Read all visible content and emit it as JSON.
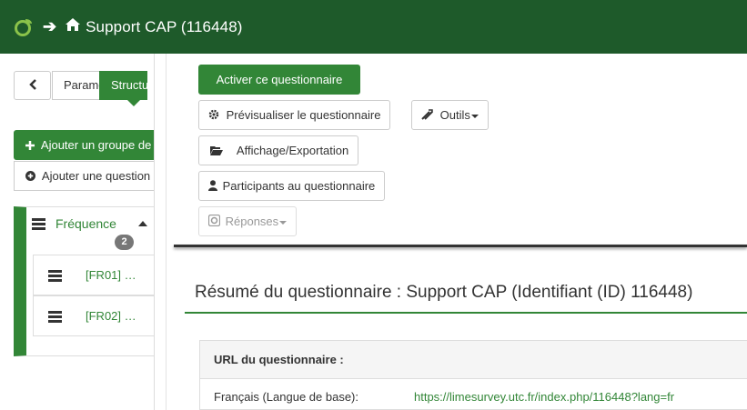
{
  "header": {
    "title": "Support CAP (116448)",
    "brand_color": "#1e5a2a"
  },
  "sidebar": {
    "tab_settings": "Paramètres",
    "tab_structure": "Structure",
    "add_group": "Ajouter un groupe de questions",
    "add_question": "Ajouter une question",
    "group": {
      "name": "Fréquence",
      "count": "2",
      "questions": [
        {
          "label": "[FR01] …"
        },
        {
          "label": "[FR02] …"
        }
      ]
    }
  },
  "toolbar": {
    "activate": "Activer ce questionnaire",
    "preview": "Prévisualiser le questionnaire",
    "tools": "Outils",
    "display_export": "Affichage/Exportation",
    "participants": "Participants au questionnaire",
    "responses": "Réponses"
  },
  "summary": {
    "title": "Résumé du questionnaire : Support CAP (Identifiant (ID) 116448)",
    "url_header": "URL du questionnaire :",
    "language_label": "Français (Langue de base):",
    "url": "https://limesurvey.utc.fr/index.php/116448?lang=fr"
  },
  "colors": {
    "accent": "#328637",
    "badge": "#777777"
  }
}
